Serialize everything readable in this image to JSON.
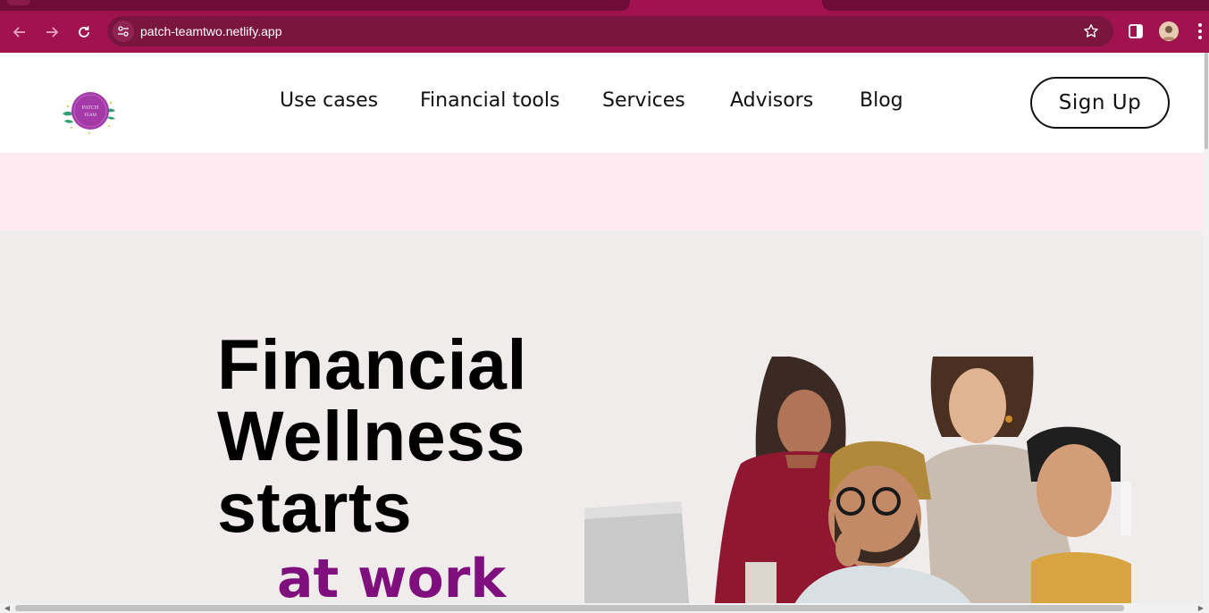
{
  "browser": {
    "url": "patch-teamtwo.netlify.app",
    "icons": [
      "back-arrow-icon",
      "forward-arrow-icon",
      "reload-icon",
      "site-info-icon",
      "star-icon",
      "side-panel-icon",
      "profile-avatar",
      "more-menu-icon"
    ],
    "accent_color": "#a0134f"
  },
  "header": {
    "nav": [
      {
        "label": "Use cases"
      },
      {
        "label": "Financial tools"
      },
      {
        "label": "Services"
      },
      {
        "label": "Advisors"
      },
      {
        "label": "Blog"
      }
    ],
    "signup_label": "Sign Up"
  },
  "hero": {
    "title_line1": "Financial",
    "title_line2": "Wellness",
    "title_line3": "starts",
    "accent": "at work",
    "accent_color": "#7e0f7c",
    "band_color": "#fdebf1"
  }
}
